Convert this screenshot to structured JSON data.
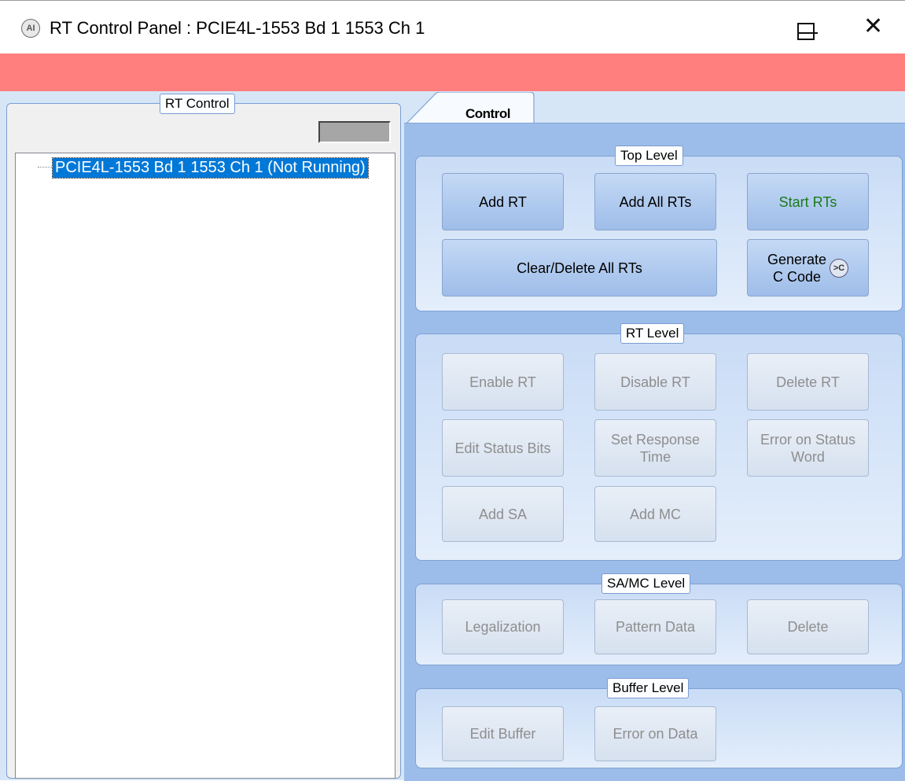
{
  "window": {
    "title": "RT Control Panel : PCIE4L-1553 Bd 1 1553 Ch 1",
    "icon": "app-logo-icon",
    "min_glyph": "—",
    "max_glyph": "☐",
    "close_glyph": "✕"
  },
  "banner": {
    "color": "#ff7f7f"
  },
  "left_panel": {
    "legend": "RT Control",
    "tree_node": "PCIE4L-1553 Bd 1 1553 Ch 1 (Not Running)"
  },
  "tabs": [
    {
      "label": "Control"
    }
  ],
  "groups": {
    "top_level": {
      "legend": "Top Level",
      "add_rt": "Add RT",
      "add_all_rts": "Add All RTs",
      "start_rts": "Start RTs",
      "clear_delete_all": "Clear/Delete All RTs",
      "generate_line1": "Generate",
      "generate_line2": "C Code",
      "generate_icon": "c-code-icon"
    },
    "rt_level": {
      "legend": "RT Level",
      "enable_rt": "Enable RT",
      "disable_rt": "Disable RT",
      "delete_rt": "Delete RT",
      "edit_status_bits": "Edit Status Bits",
      "set_response_line1": "Set Response",
      "set_response_line2": "Time",
      "error_status_line1": "Error on Status",
      "error_status_line2": "Word",
      "add_sa": "Add SA",
      "add_mc": "Add MC"
    },
    "samc_level": {
      "legend": "SA/MC Level",
      "legalization": "Legalization",
      "pattern_data": "Pattern Data",
      "delete": "Delete"
    },
    "buffer_level": {
      "legend": "Buffer Level",
      "edit_buffer": "Edit Buffer",
      "error_on_data": "Error on Data"
    }
  },
  "colors": {
    "start_rts_text": "#1a7a1a",
    "selection": "#0078d7",
    "panel": "#9cbde9"
  }
}
